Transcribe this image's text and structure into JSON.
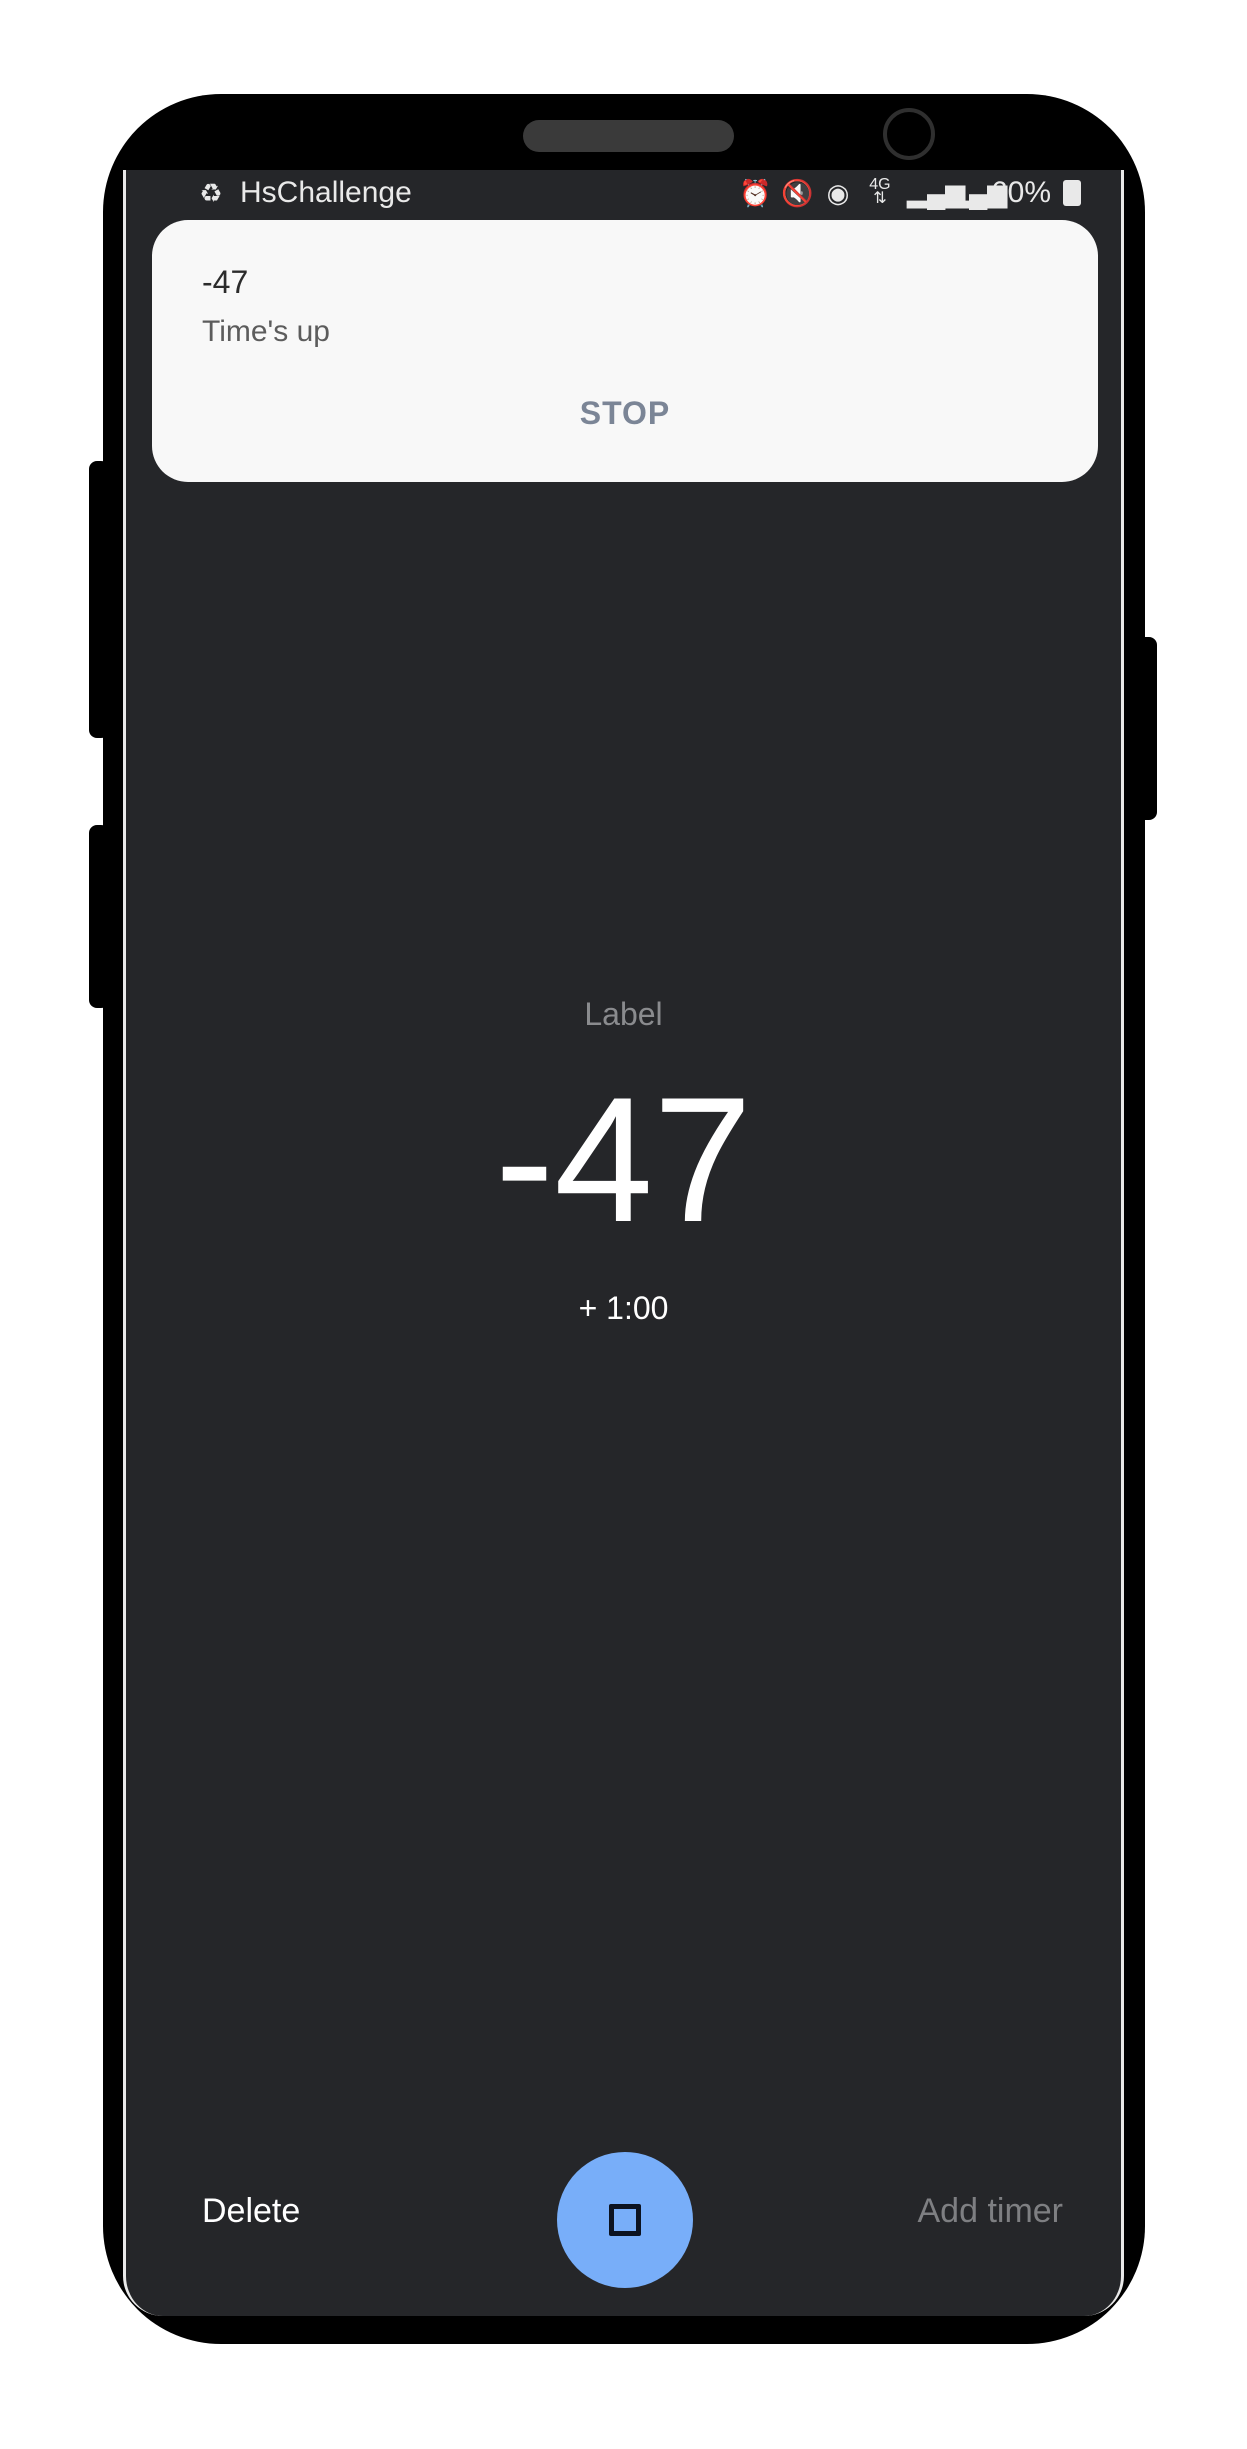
{
  "status_bar": {
    "app_name": "HsChallenge",
    "app_icon": "recycle-icon",
    "icons": [
      "alarm-icon",
      "mute-icon",
      "hotspot-icon",
      "4g-icon",
      "signal-icon",
      "signal-icon"
    ],
    "battery_percent": "60%"
  },
  "notification": {
    "title": "-47",
    "text": "Time's up",
    "action_label": "STOP"
  },
  "timer": {
    "label": "Label",
    "value": "-47",
    "add_minute_label": "+ 1:00"
  },
  "bottom_bar": {
    "delete_label": "Delete",
    "add_timer_label": "Add timer",
    "fab_icon": "stop-icon"
  },
  "colors": {
    "background": "#252629",
    "fab": "#78aef9",
    "notification_bg": "#f8f8f8",
    "action": "#7b8596"
  }
}
